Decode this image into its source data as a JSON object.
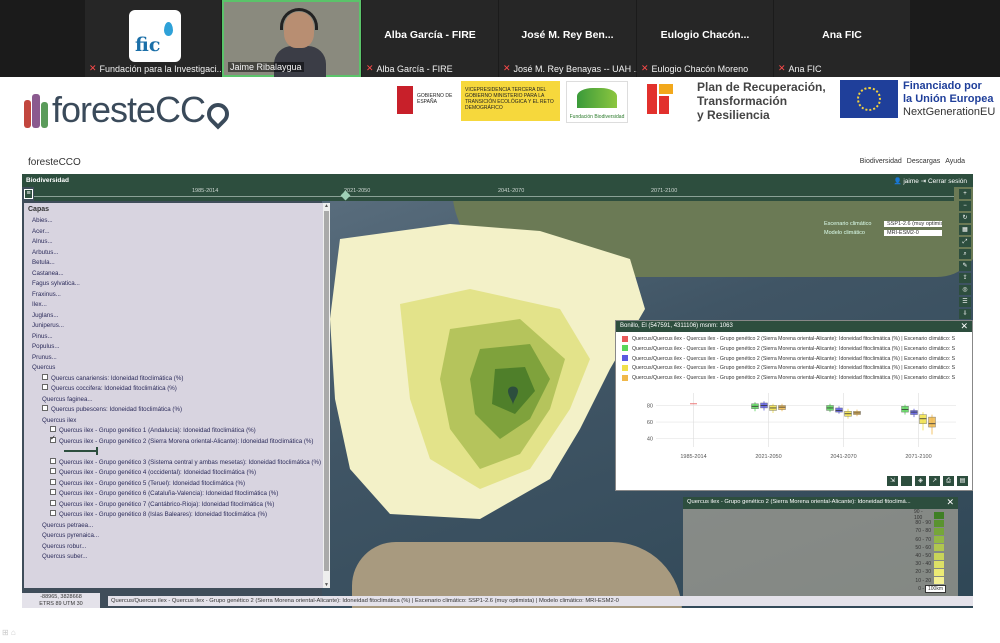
{
  "call": {
    "participants": [
      {
        "tile_name": "",
        "label": "Fundación para la Investigaci..."
      },
      {
        "tile_name": "",
        "label": "Jaime Ribalaygua"
      },
      {
        "tile_name": "Alba García - FIRE",
        "label": "Alba García - FIRE"
      },
      {
        "tile_name": "José M. Rey Ben...",
        "label": "José M. Rey Benayas -- UAH ..."
      },
      {
        "tile_name": "Eulogio  Chacón...",
        "label": "Eulogio Chacón Moreno"
      },
      {
        "tile_name": "Ana FIC",
        "label": "Ana FIC"
      }
    ],
    "fic_logo_text": "fic"
  },
  "header": {
    "logo_text": "foresteCC",
    "gob_text": "VICEPRESIDENCIA TERCERA DEL GOBIERNO MINISTERIO PARA LA TRANSICIÓN ECOLÓGICA Y EL RETO DEMOGRÁFICO",
    "gob_left": "GOBIERNO DE ESPAÑA",
    "biod_label": "Fundación Biodiversidad",
    "plan_lines": [
      "Plan de Recuperación,",
      "Transformación",
      "y Resiliencia"
    ],
    "eu_lines": [
      "Financiado por",
      "la Unión Europea"
    ],
    "eu_sub": "NextGenerationEU"
  },
  "app": {
    "logo": "foresteCCO",
    "nav": [
      "Biodiversidad",
      "Descargas",
      "Ayuda"
    ],
    "section": "Biodiversidad",
    "user": "jaime",
    "logout": "Cerrar sesión",
    "timeline": [
      "1985-2014",
      "2021-2050",
      "2041-2070",
      "2071-2100"
    ],
    "timeline_selected": "2021-2050",
    "climate": {
      "scenario_label": "Escenario climático",
      "scenario_value": "SSP1-2.6 (muy optimista)",
      "model_label": "Modelo climático",
      "model_value": "MRI-ESM2-0"
    }
  },
  "layers": {
    "title": "Capas",
    "genera": [
      "Abies...",
      "Acer...",
      "Alnus...",
      "Arbutus...",
      "Betula...",
      "Castanea...",
      "Fagus sylvatica...",
      "Fraxinus...",
      "Ilex...",
      "Juglans...",
      "Juniperus...",
      "Pinus...",
      "Populus...",
      "Prunus..."
    ],
    "quercus": "Quercus",
    "quercus_items": [
      {
        "label": "Quercus canariensis: Idoneidad fitoclimática (%)",
        "checked": false
      },
      {
        "label": "Quercus coccifera: Idoneidad fitoclimática (%)",
        "checked": false
      },
      {
        "label": "Quercus faginea...",
        "checked": null
      },
      {
        "label": "Quercus pubescens: Idoneidad fitoclimática (%)",
        "checked": false
      },
      {
        "label": "Quercus ilex",
        "checked": null
      }
    ],
    "ilex_items": [
      {
        "label": "Quercus ilex - Grupo genético 1 (Andalucía): Idoneidad fitoclimática (%)",
        "checked": false
      },
      {
        "label": "Quercus ilex - Grupo genético 2 (Sierra Morena oriental-Alicante): Idoneidad fitoclimática (%)",
        "checked": true
      },
      {
        "label": "Quercus ilex - Grupo genético 3 (Sistema central y ambas mesetas): Idoneidad fitoclimática (%)",
        "checked": false
      },
      {
        "label": "Quercus ilex - Grupo genético 4 (occidental): Idoneidad fitoclimática (%)",
        "checked": false
      },
      {
        "label": "Quercus ilex - Grupo genético 5 (Teruel): Idoneidad fitoclimática (%)",
        "checked": false
      },
      {
        "label": "Quercus ilex - Grupo genético 6 (Cataluña-Valencia): Idoneidad fitoclimática (%)",
        "checked": false
      },
      {
        "label": "Quercus ilex - Grupo genético 7 (Cantábrico-Rioja): Idoneidad fitoclimática (%)",
        "checked": false
      },
      {
        "label": "Quercus ilex - Grupo genético 8 (Islas Baleares): Idoneidad fitoclimática (%)",
        "checked": false
      }
    ],
    "more": [
      "Quercus petraea...",
      "Quercus pyrenaica...",
      "Quercus robur...",
      "Quercus suber..."
    ]
  },
  "popup": {
    "title": "Bonillo, El (547591, 4311106) msnm: 1063",
    "rows": [
      {
        "label": "Quercus/Quercus ilex - Quercus ilex - Grupo genético 2 (Sierra Morena oriental-Alicante): Idoneidad fitoclimática (%) | Escenario climático: S",
        "color": "#e85a5a"
      },
      {
        "label": "Quercus/Quercus ilex - Quercus ilex - Grupo genético 2 (Sierra Morena oriental-Alicante): Idoneidad fitoclimática (%) | Escenario climático: S",
        "color": "#5ad65a"
      },
      {
        "label": "Quercus/Quercus ilex - Quercus ilex - Grupo genético 2 (Sierra Morena oriental-Alicante): Idoneidad fitoclimática (%) | Escenario climático: S",
        "color": "#5a5ae0"
      },
      {
        "label": "Quercus/Quercus ilex - Quercus ilex - Grupo genético 2 (Sierra Morena oriental-Alicante): Idoneidad fitoclimática (%) | Escenario climático: S",
        "color": "#f0e04a"
      },
      {
        "label": "Quercus/Quercus ilex - Quercus ilex - Grupo genético 2 (Sierra Morena oriental-Alicante): Idoneidad fitoclimática (%) | Escenario climático: S",
        "color": "#f0b84a"
      }
    ]
  },
  "chart_data": {
    "type": "box",
    "categories": [
      "1985-2014",
      "2021-2050",
      "2041-2070",
      "2071-2100"
    ],
    "yticks": [
      40,
      60,
      80
    ],
    "ylim": [
      30,
      95
    ],
    "series": [
      {
        "color": "#e85a5a",
        "boxes": [
          [
            82,
            82,
            82,
            82,
            82
          ],
          null,
          null,
          null
        ]
      },
      {
        "color": "#5ad65a",
        "boxes": [
          null,
          [
            73,
            76,
            79,
            82,
            84
          ],
          [
            72,
            74,
            77,
            80,
            82
          ],
          [
            69,
            72,
            75,
            79,
            81
          ]
        ]
      },
      {
        "color": "#5a5ae0",
        "boxes": [
          null,
          [
            74,
            77,
            80,
            83,
            85
          ],
          [
            70,
            72,
            74,
            77,
            79
          ],
          [
            66,
            69,
            72,
            74,
            76
          ]
        ]
      },
      {
        "color": "#f0e04a",
        "boxes": [
          null,
          [
            71,
            74,
            77,
            80,
            82
          ],
          [
            64,
            67,
            70,
            73,
            76
          ],
          [
            50,
            58,
            64,
            69,
            72
          ]
        ]
      },
      {
        "color": "#f0b84a",
        "boxes": [
          null,
          [
            73,
            75,
            78,
            80,
            82
          ],
          [
            67,
            69,
            71,
            73,
            75
          ],
          [
            45,
            54,
            58,
            66,
            69
          ]
        ]
      }
    ]
  },
  "legend_panel": {
    "title": "Quercus ilex - Grupo genético 2 (Sierra Morena oriental-Alicante): Idoneidad fitoclimá...",
    "scale": [
      {
        "label": "90 - 100",
        "color": "#3f7f25"
      },
      {
        "label": "80 - 90",
        "color": "#5a9330"
      },
      {
        "label": "70 - 80",
        "color": "#76a63a"
      },
      {
        "label": "60 - 70",
        "color": "#93b845"
      },
      {
        "label": "50 - 60",
        "color": "#b0c64f"
      },
      {
        "label": "40 - 50",
        "color": "#c8d459"
      },
      {
        "label": "30 - 40",
        "color": "#dde066"
      },
      {
        "label": "20 - 30",
        "color": "#ecea74"
      },
      {
        "label": "10 - 20",
        "color": "#f4f094"
      },
      {
        "label": "0 - 10",
        "color": "#f8f6bf"
      }
    ],
    "scalebar": "100km"
  },
  "status": {
    "coords_line1": "-88965, 3828668",
    "coords_line2": "ETRS 89 UTM 30",
    "text": "Quercus/Quercus ilex - Quercus ilex - Grupo genético 2 (Sierra Morena oriental-Alicante): Idoneidad fitoclimática (%) | Escenario climático: SSP1-2.6 (muy optimista) | Modelo climático: MRI-ESM2-0"
  }
}
